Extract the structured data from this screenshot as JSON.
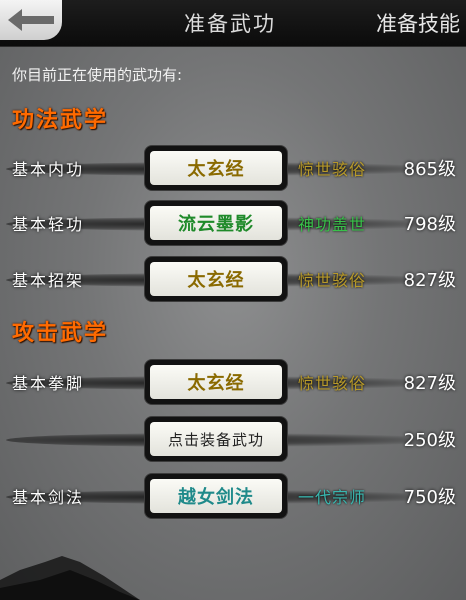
{
  "header": {
    "title": "准备武功",
    "tab_right": "准备技能",
    "back_icon": "arrow-left-icon"
  },
  "intro": "你目前正在使用的武功有:",
  "sections": [
    {
      "title": "功法武学"
    },
    {
      "title": "攻击武学"
    }
  ],
  "rows": [
    {
      "label": "基本内功",
      "skill": "太玄经",
      "skill_color": "#8a6a00",
      "rank": "惊世骇俗",
      "rank_color": "#b89a2a",
      "level": "865级"
    },
    {
      "label": "基本轻功",
      "skill": "流云墨影",
      "skill_color": "#1f8a2a",
      "rank": "神功盖世",
      "rank_color": "#39c24a",
      "level": "798级"
    },
    {
      "label": "基本招架",
      "skill": "太玄经",
      "skill_color": "#8a6a00",
      "rank": "惊世骇俗",
      "rank_color": "#b89a2a",
      "level": "827级"
    },
    {
      "label": "基本拳脚",
      "skill": "太玄经",
      "skill_color": "#8a6a00",
      "rank": "惊世骇俗",
      "rank_color": "#b89a2a",
      "level": "827级"
    },
    {
      "label": "",
      "skill": "点击装备武功",
      "skill_color": "#222222",
      "rank": "",
      "rank_color": "#ffffff",
      "level": "250级"
    },
    {
      "label": "基本剑法",
      "skill": "越女剑法",
      "skill_color": "#1f8a8a",
      "rank": "一代宗师",
      "rank_color": "#39b8b0",
      "level": "750级"
    }
  ]
}
